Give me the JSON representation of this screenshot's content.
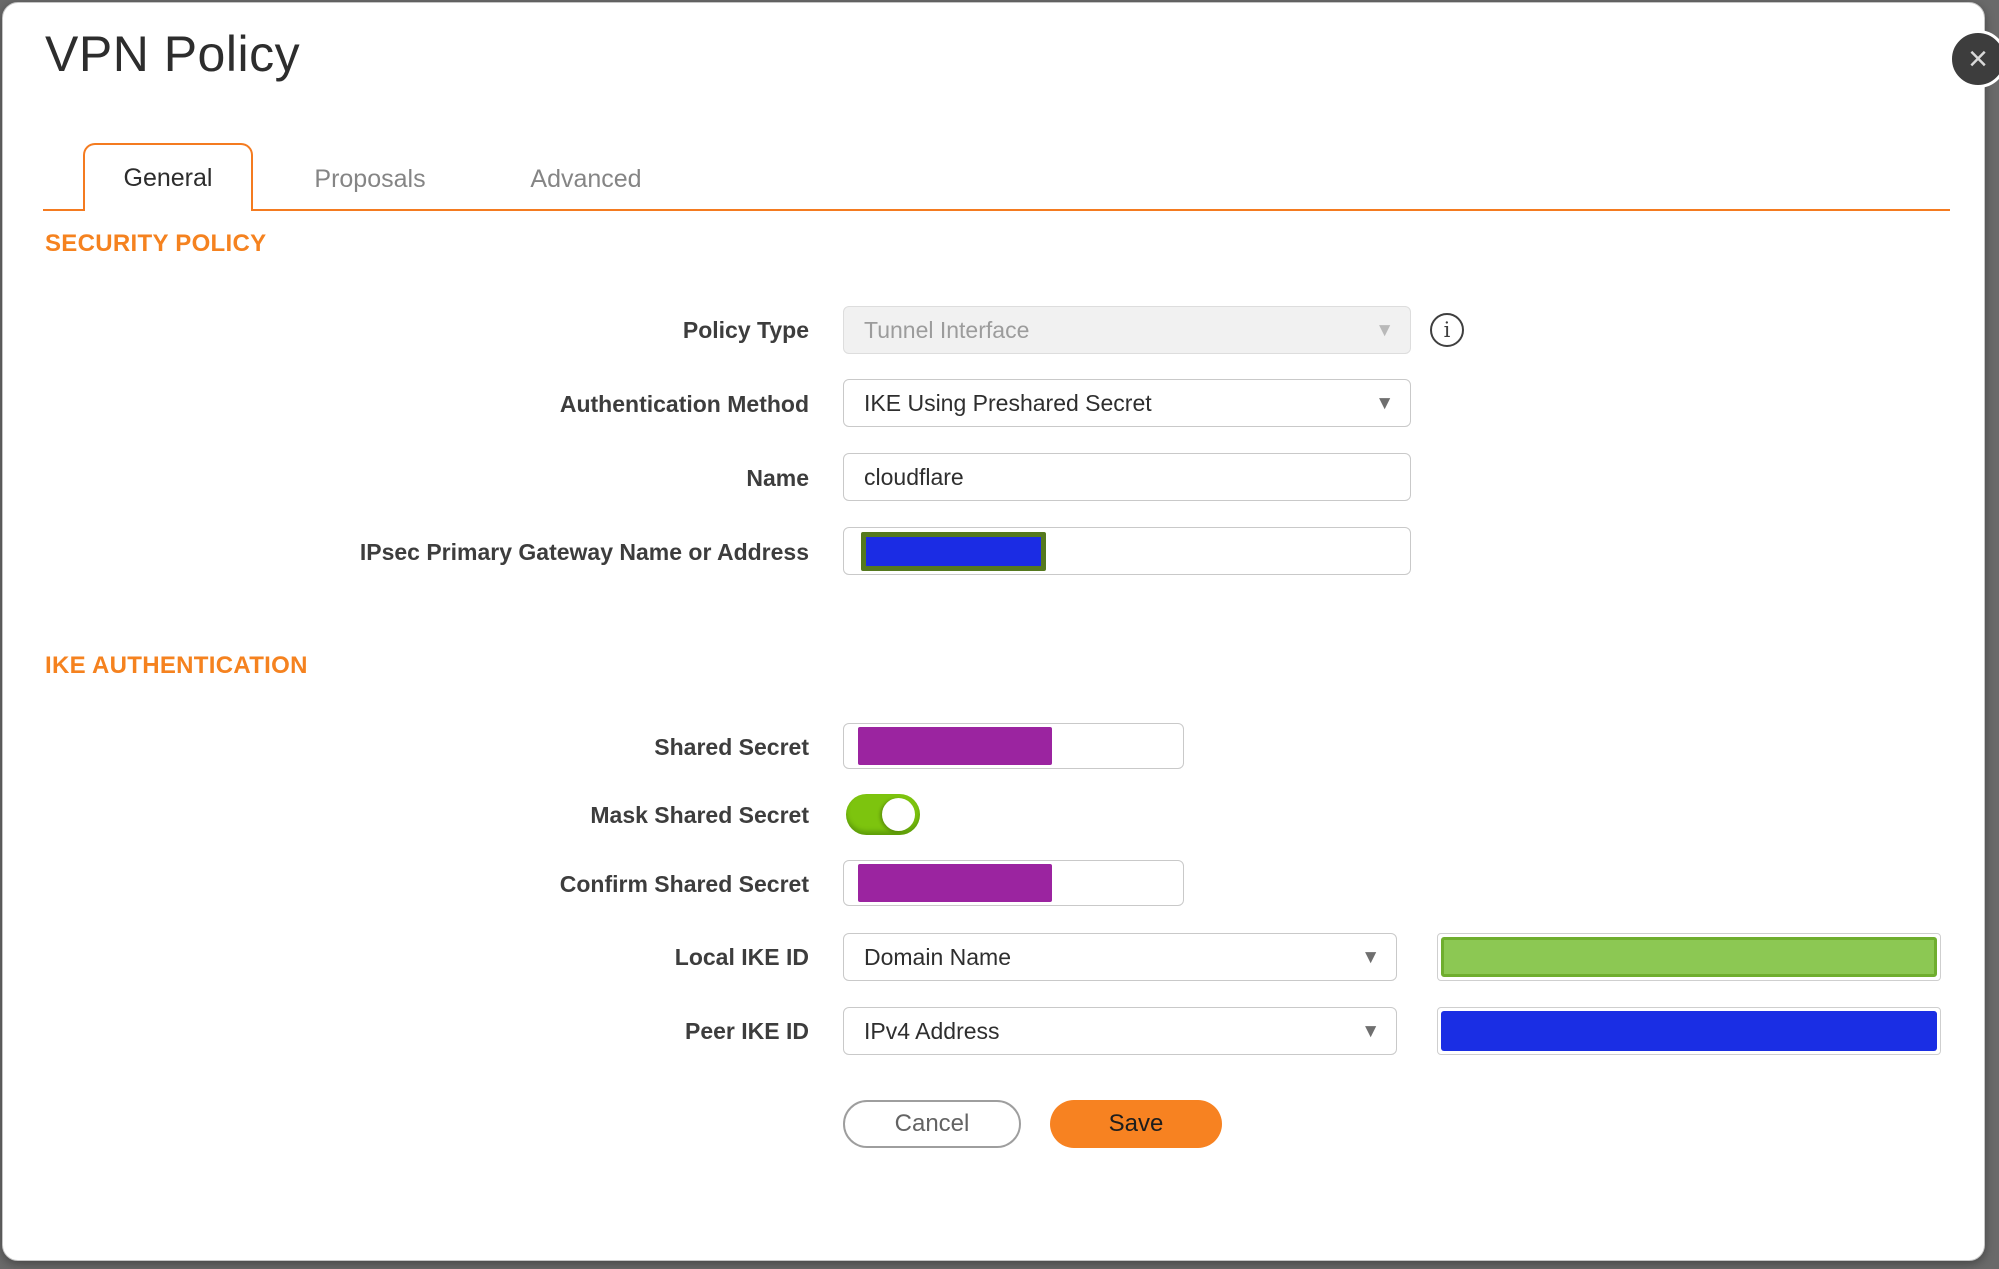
{
  "window": {
    "title": "VPN Policy"
  },
  "tabs": [
    {
      "label": "General",
      "active": true
    },
    {
      "label": "Proposals",
      "active": false
    },
    {
      "label": "Advanced",
      "active": false
    }
  ],
  "sections": [
    {
      "heading": "SECURITY POLICY"
    },
    {
      "heading": "IKE AUTHENTICATION"
    }
  ],
  "fields": {
    "policy_type": {
      "label": "Policy Type",
      "value": "Tunnel Interface",
      "state": "disabled"
    },
    "authentication_method": {
      "label": "Authentication Method",
      "value": "IKE Using Preshared Secret"
    },
    "name": {
      "label": "Name",
      "value": "cloudflare"
    },
    "gateway": {
      "label": "IPsec Primary Gateway Name or Address",
      "value_redacted": true
    },
    "shared_secret": {
      "label": "Shared Secret",
      "value_redacted": true
    },
    "mask_shared_secret": {
      "label": "Mask Shared Secret",
      "toggle_on": true
    },
    "confirm_shared_secret": {
      "label": "Confirm Shared Secret",
      "value_redacted": true
    },
    "local_ike_id": {
      "label": "Local IKE ID",
      "value": "Domain Name",
      "value_field_redacted": true
    },
    "peer_ike_id": {
      "label": "Peer IKE ID",
      "value": "IPv4 Address",
      "value_field_redacted": true
    }
  },
  "buttons": {
    "cancel_label": "Cancel",
    "save_label": "Save"
  },
  "icons": {
    "close": "×",
    "info": "i",
    "dropdown": "▼"
  },
  "colors": {
    "accent_orange": "#f47b20",
    "save_button_orange": "#f78221",
    "toggle_green": "#7dc40e",
    "redaction_purple": "#9b24a0",
    "redaction_blue": "#1a2ee4",
    "redaction_green_fill": "#8cc853",
    "redaction_green_border": "#6fae2e",
    "gateway_redaction_border_olive": "#55791e",
    "backdrop_gray": "#6a6a6a",
    "close_button_gray": "#3d3d3d"
  }
}
